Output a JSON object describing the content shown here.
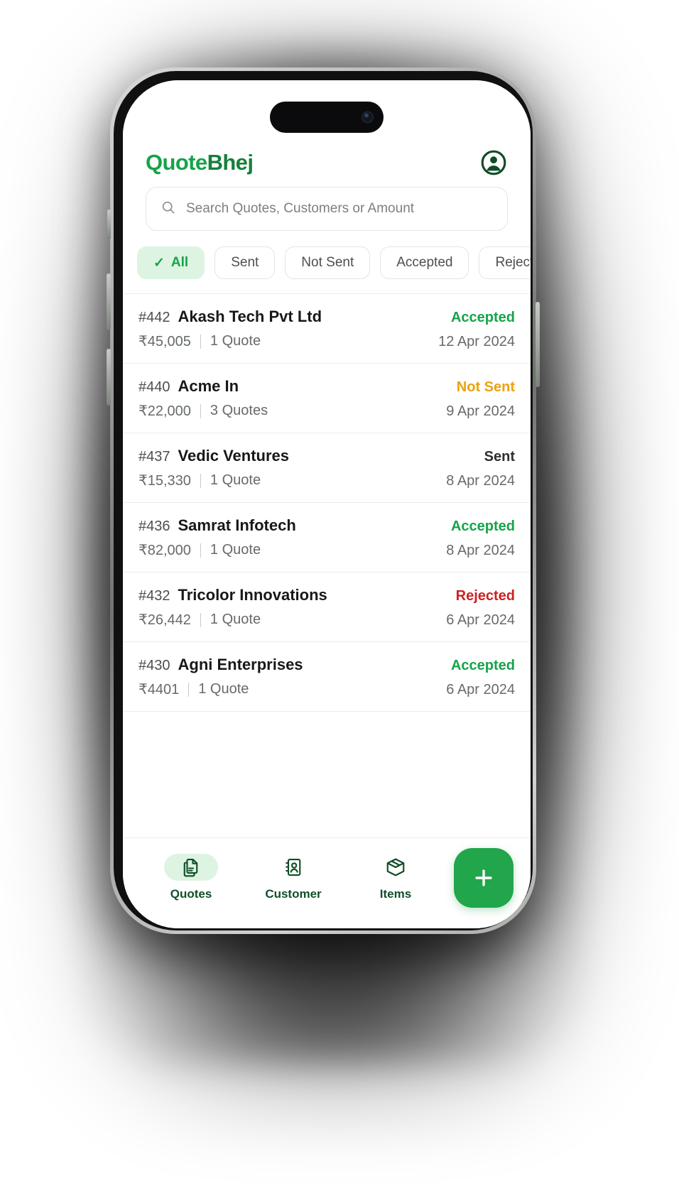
{
  "app": {
    "brand_main": "Quote",
    "brand_accent": "Bhej",
    "avatar_icon": "account-circle-icon"
  },
  "search": {
    "icon": "search-icon",
    "placeholder": "Search Quotes, Customers or Amount",
    "value": ""
  },
  "filters": {
    "check_glyph": "✓",
    "chips": [
      {
        "label": "All",
        "active": true
      },
      {
        "label": "Sent",
        "active": false
      },
      {
        "label": "Not Sent",
        "active": false
      },
      {
        "label": "Accepted",
        "active": false
      },
      {
        "label": "Rejected",
        "active": false
      }
    ]
  },
  "quotes": [
    {
      "id": "#442",
      "customer": "Akash Tech Pvt Ltd",
      "amount": "₹45,005",
      "count": "1 Quote",
      "status": "Accepted",
      "status_kind": "accepted",
      "date": "12 Apr 2024"
    },
    {
      "id": "#440",
      "customer": "Acme In",
      "amount": "₹22,000",
      "count": "3 Quotes",
      "status": "Not Sent",
      "status_kind": "notsent",
      "date": "9 Apr 2024"
    },
    {
      "id": "#437",
      "customer": "Vedic Ventures",
      "amount": "₹15,330",
      "count": "1 Quote",
      "status": "Sent",
      "status_kind": "sent",
      "date": "8 Apr 2024"
    },
    {
      "id": "#436",
      "customer": "Samrat Infotech",
      "amount": "₹82,000",
      "count": "1 Quote",
      "status": "Accepted",
      "status_kind": "accepted",
      "date": "8 Apr 2024"
    },
    {
      "id": "#432",
      "customer": "Tricolor Innovations",
      "amount": "₹26,442",
      "count": "1 Quote",
      "status": "Rejected",
      "status_kind": "rejected",
      "date": "6 Apr 2024"
    },
    {
      "id": "#430",
      "customer": "Agni Enterprises",
      "amount": "₹4401",
      "count": "1 Quote",
      "status": "Accepted",
      "status_kind": "accepted",
      "date": "6 Apr 2024"
    }
  ],
  "bottom_nav": {
    "items": [
      {
        "label": "Quotes",
        "icon": "documents-icon",
        "active": true
      },
      {
        "label": "Customer",
        "icon": "contact-book-icon",
        "active": false
      },
      {
        "label": "Items",
        "icon": "box-icon",
        "active": false
      }
    ],
    "fab": {
      "icon": "plus-icon",
      "label": "+"
    }
  },
  "colors": {
    "brand_green": "#16a34a",
    "brand_dark_green": "#157f3c",
    "accepted": "#16a34a",
    "not_sent": "#eca10d",
    "rejected": "#cc2222",
    "sent": "#2b2f2d",
    "chip_active_bg": "#ddf4e3",
    "fab_bg": "#21a64c"
  }
}
